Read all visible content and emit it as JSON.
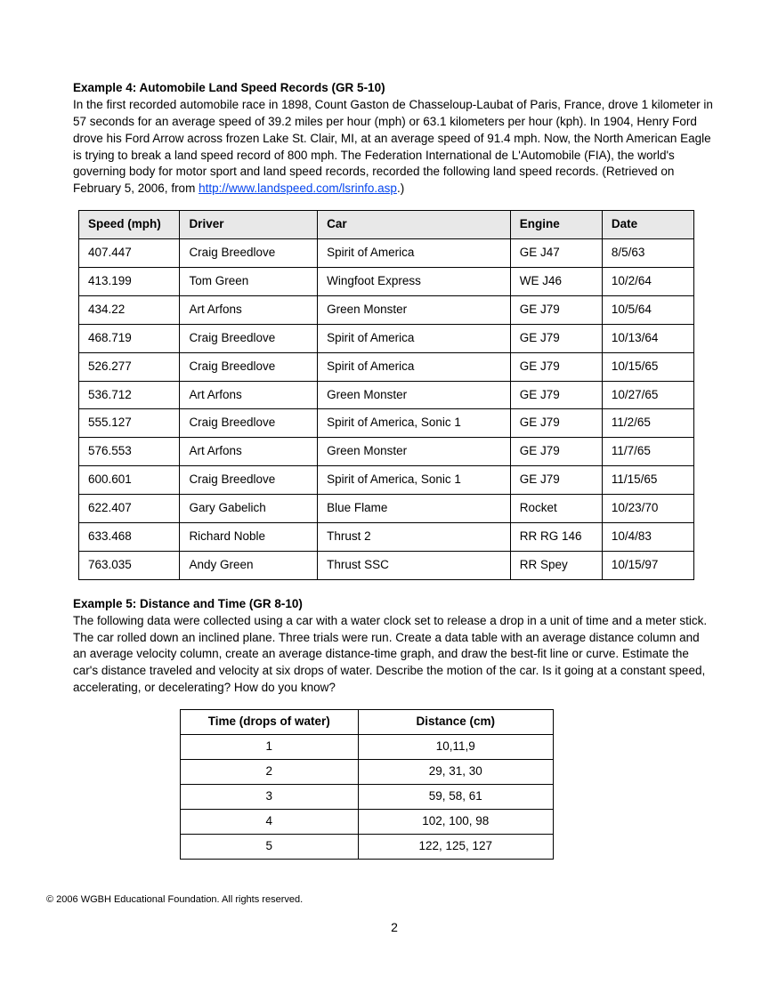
{
  "example4": {
    "heading": "Example 4: Automobile Land Speed Records (GR 5-10)",
    "body_before_link": "In the first recorded automobile race in 1898, Count Gaston de Chasseloup-Laubat of Paris, France, drove 1 kilometer in 57 seconds for an average speed of 39.2 miles per hour (mph) or 63.1 kilometers per hour (kph). In 1904, Henry Ford drove his Ford Arrow across frozen Lake St. Clair, MI, at an average speed of 91.4 mph. Now, the North American Eagle is trying to break a land speed record of 800 mph. The Federation International de L'Automobile (FIA), the world's governing body for motor sport and land speed records, recorded the following land speed records. (Retrieved on February 5, 2006, from ",
    "link_text": "http://www.landspeed.com/lsrinfo.asp",
    "body_after_link": ".)"
  },
  "speed_table": {
    "headers": {
      "speed": "Speed (mph)",
      "driver": "Driver",
      "car": "Car",
      "engine": "Engine",
      "date": "Date"
    },
    "rows": [
      {
        "speed": "407.447",
        "driver": "Craig Breedlove",
        "car": "Spirit of America",
        "engine": "GE J47",
        "date": "8/5/63"
      },
      {
        "speed": "413.199",
        "driver": "Tom Green",
        "car": "Wingfoot Express",
        "engine": "WE J46",
        "date": "10/2/64"
      },
      {
        "speed": "434.22",
        "driver": "Art Arfons",
        "car": "Green Monster",
        "engine": "GE J79",
        "date": "10/5/64"
      },
      {
        "speed": "468.719",
        "driver": "Craig Breedlove",
        "car": "Spirit of America",
        "engine": "GE J79",
        "date": "10/13/64"
      },
      {
        "speed": "526.277",
        "driver": "Craig Breedlove",
        "car": "Spirit of America",
        "engine": "GE J79",
        "date": "10/15/65"
      },
      {
        "speed": "536.712",
        "driver": "Art Arfons",
        "car": "Green Monster",
        "engine": "GE J79",
        "date": "10/27/65"
      },
      {
        "speed": "555.127",
        "driver": "Craig Breedlove",
        "car": "Spirit of America, Sonic 1",
        "engine": "GE J79",
        "date": "11/2/65"
      },
      {
        "speed": "576.553",
        "driver": "Art Arfons",
        "car": "Green Monster",
        "engine": "GE J79",
        "date": "11/7/65"
      },
      {
        "speed": "600.601",
        "driver": "Craig Breedlove",
        "car": "Spirit of America, Sonic 1",
        "engine": "GE J79",
        "date": "11/15/65"
      },
      {
        "speed": "622.407",
        "driver": "Gary Gabelich",
        "car": "Blue Flame",
        "engine": "Rocket",
        "date": "10/23/70"
      },
      {
        "speed": "633.468",
        "driver": "Richard Noble",
        "car": "Thrust 2",
        "engine": "RR RG 146",
        "date": "10/4/83"
      },
      {
        "speed": "763.035",
        "driver": "Andy Green",
        "car": "Thrust SSC",
        "engine": "RR Spey",
        "date": "10/15/97"
      }
    ]
  },
  "example5": {
    "heading": "Example 5: Distance and Time (GR 8-10)",
    "body": "The following data were collected using a car with a water clock set to release a drop in a unit of time and a meter stick. The car rolled down an inclined plane. Three trials were run. Create a data table with an average distance column and an average velocity column, create an average distance-time graph, and draw the best-fit line or curve. Estimate the car's distance traveled and velocity at six drops of water. Describe the motion of the car. Is it going at a constant speed, accelerating, or decelerating? How do you know?"
  },
  "dist_table": {
    "headers": {
      "time": "Time (drops of water)",
      "dist": "Distance (cm)"
    },
    "rows": [
      {
        "time": "1",
        "dist": "10,11,9"
      },
      {
        "time": "2",
        "dist": "29, 31, 30"
      },
      {
        "time": "3",
        "dist": "59, 58, 61"
      },
      {
        "time": "4",
        "dist": "102, 100, 98"
      },
      {
        "time": "5",
        "dist": "122, 125, 127"
      }
    ]
  },
  "footer": "© 2006 WGBH Educational Foundation. All rights reserved.",
  "page_number": "2",
  "chart_data": [
    {
      "type": "table",
      "title": "Automobile Land Speed Records",
      "columns": [
        "Speed (mph)",
        "Driver",
        "Car",
        "Engine",
        "Date"
      ],
      "rows": [
        [
          407.447,
          "Craig Breedlove",
          "Spirit of America",
          "GE J47",
          "8/5/63"
        ],
        [
          413.199,
          "Tom Green",
          "Wingfoot Express",
          "WE J46",
          "10/2/64"
        ],
        [
          434.22,
          "Art Arfons",
          "Green Monster",
          "GE J79",
          "10/5/64"
        ],
        [
          468.719,
          "Craig Breedlove",
          "Spirit of America",
          "GE J79",
          "10/13/64"
        ],
        [
          526.277,
          "Craig Breedlove",
          "Spirit of America",
          "GE J79",
          "10/15/65"
        ],
        [
          536.712,
          "Art Arfons",
          "Green Monster",
          "GE J79",
          "10/27/65"
        ],
        [
          555.127,
          "Craig Breedlove",
          "Spirit of America, Sonic 1",
          "GE J79",
          "11/2/65"
        ],
        [
          576.553,
          "Art Arfons",
          "Green Monster",
          "GE J79",
          "11/7/65"
        ],
        [
          600.601,
          "Craig Breedlove",
          "Spirit of America, Sonic 1",
          "GE J79",
          "11/15/65"
        ],
        [
          622.407,
          "Gary Gabelich",
          "Blue Flame",
          "Rocket",
          "10/23/70"
        ],
        [
          633.468,
          "Richard Noble",
          "Thrust 2",
          "RR RG 146",
          "10/4/83"
        ],
        [
          763.035,
          "Andy Green",
          "Thrust SSC",
          "RR Spey",
          "10/15/97"
        ]
      ]
    },
    {
      "type": "table",
      "title": "Distance and Time",
      "columns": [
        "Time (drops of water)",
        "Distance (cm)"
      ],
      "rows": [
        [
          1,
          "10,11,9"
        ],
        [
          2,
          "29, 31, 30"
        ],
        [
          3,
          "59, 58, 61"
        ],
        [
          4,
          "102, 100, 98"
        ],
        [
          5,
          "122, 125, 127"
        ]
      ]
    }
  ]
}
